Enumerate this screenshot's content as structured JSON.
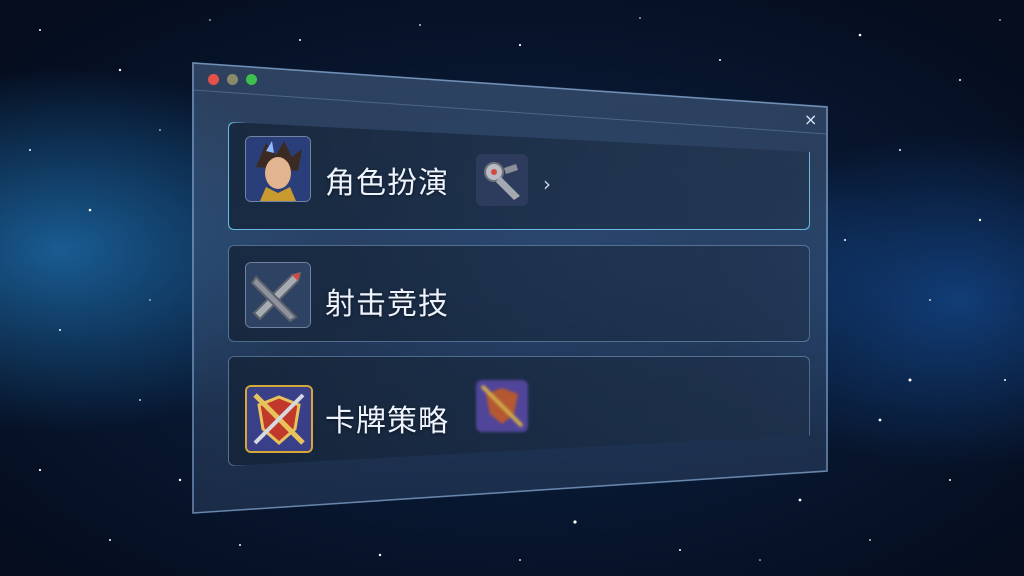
{
  "window": {
    "close_label": "×"
  },
  "genres": [
    {
      "label": "角色扮演",
      "icon": "hero-portrait-icon",
      "secondary_icon": "blaster-icon",
      "expand_label": "›",
      "active": true
    },
    {
      "label": "射击竞技",
      "icon": "crossed-weapons-icon",
      "active": false
    },
    {
      "label": "卡牌策略",
      "icon": "sword-shield-card-icon",
      "secondary_icon": "blurred-card-icon",
      "active": false
    }
  ],
  "colors": {
    "accent": "#6fd0ff",
    "panel": "#2a3f5e"
  }
}
